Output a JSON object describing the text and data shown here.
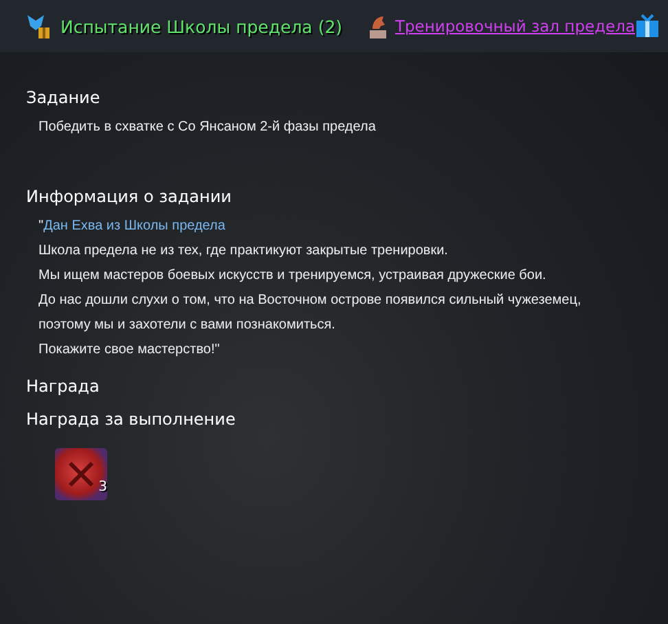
{
  "header": {
    "title": "Испытание Школы предела (2)",
    "location_link": "Тренировочный зал предела"
  },
  "task": {
    "heading": "Задание",
    "text": "Победить в схватке с Со Янсаном 2-й фазы предела"
  },
  "info": {
    "heading": "Информация о задании",
    "open_quote": "\"",
    "speaker": "Дан Ехва из Школы предела",
    "lines": [
      "Школа предела не из тех, где практикуют закрытые тренировки.",
      "Мы ищем мастеров боевых искусств и тренируемся, устраивая дружеские бои.",
      "До нас дошли  слухи о том, что на  Восточном острове  появился сильный чужеземец,",
      "поэтому мы и захотели с вами познакомиться.",
      "Покажите свое мастерство!\""
    ]
  },
  "reward": {
    "heading": "Награда",
    "subheading": "Награда за выполнение",
    "items": [
      {
        "count": "3"
      }
    ]
  }
}
